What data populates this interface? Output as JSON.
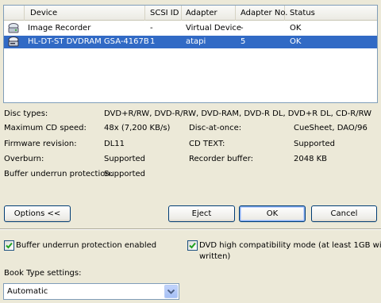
{
  "device_list": {
    "columns": [
      "Device",
      "SCSI ID",
      "Adapter",
      "Adapter No.",
      "Status"
    ],
    "rows": [
      {
        "device": "Image Recorder",
        "scsi_id": "-",
        "adapter": "Virtual Device",
        "adapter_no": "-",
        "status": "OK",
        "icon": "image-recorder-icon",
        "selected": false
      },
      {
        "device": "HL-DT-ST DVDRAM GSA-4167B",
        "scsi_id": "1",
        "adapter": "atapi",
        "adapter_no": "5",
        "status": "OK",
        "icon": "dvd-drive-icon",
        "selected": true
      }
    ]
  },
  "info": {
    "disc_types_label": "Disc types:",
    "disc_types_value": "DVD+R/RW, DVD-R/RW, DVD-RAM, DVD-R DL, DVD+R DL, CD-R/RW",
    "max_speed_label": "Maximum CD speed:",
    "max_speed_value": "48x (7,200 KB/s)",
    "firmware_label": "Firmware revision:",
    "firmware_value": "DL11",
    "overburn_label": "Overburn:",
    "overburn_value": "Supported",
    "buffer_underrun_label": "Buffer underrun protection:",
    "buffer_underrun_value": "Supported",
    "dao_label": "Disc-at-once:",
    "dao_value": "CueSheet, DAO/96",
    "cdtext_label": "CD TEXT:",
    "cdtext_value": "Supported",
    "recorder_buffer_label": "Recorder buffer:",
    "recorder_buffer_value": "2048 KB"
  },
  "buttons": {
    "options": "Options <<",
    "eject": "Eject",
    "ok": "OK",
    "cancel": "Cancel"
  },
  "checkboxes": {
    "buffer_underrun_enabled": {
      "label": "Buffer underrun protection enabled",
      "checked": true
    },
    "dvd_high_compat": {
      "label_line1": "DVD high compatibility mode (at least 1GB will be",
      "label_line2": "written)",
      "checked": true
    }
  },
  "book_type": {
    "label": "Book Type settings:",
    "selected": "Automatic"
  },
  "colors": {
    "window_bg": "#ece9d8",
    "selection": "#316ac5",
    "checkmark": "#21a121"
  }
}
